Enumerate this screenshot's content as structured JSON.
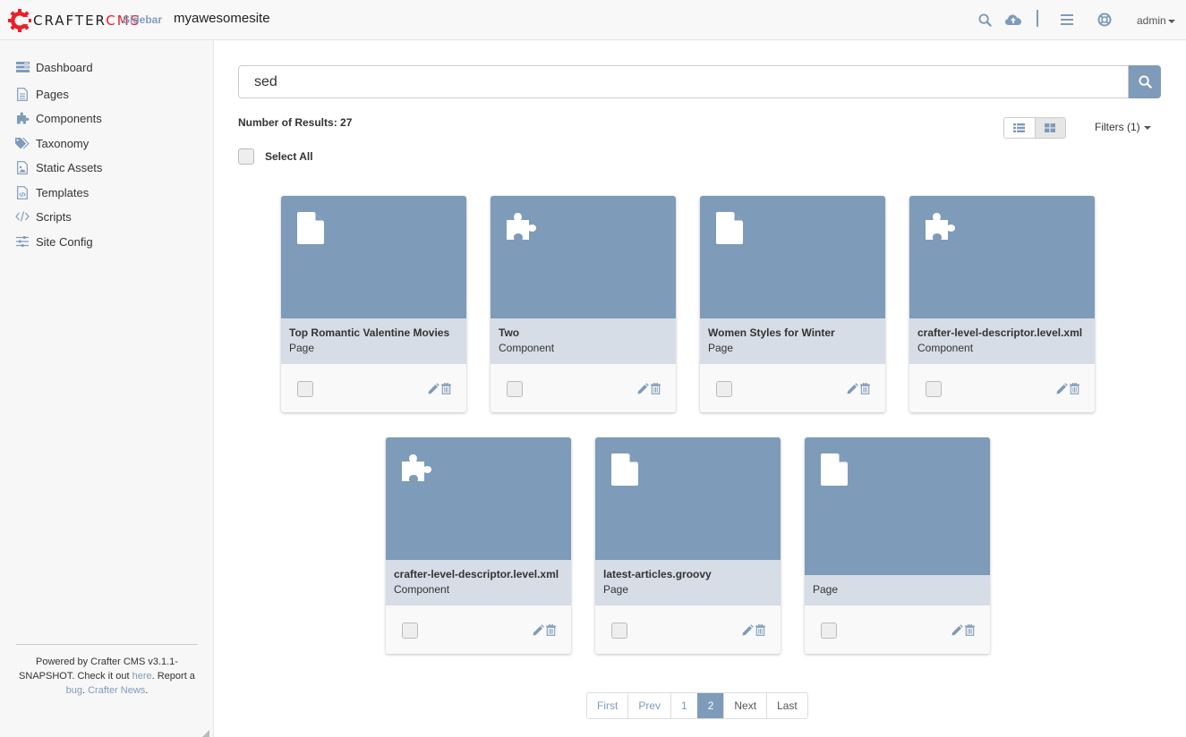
{
  "header": {
    "logo_prefix": "CRAFTER",
    "logo_suffix": "CMS",
    "sidebar_toggle": "Sidebar",
    "site_name": "myawesomesite",
    "icons": [
      "search-icon",
      "cloud-upload-icon",
      "menu-icon",
      "help-lifebuoy-icon"
    ],
    "user": "admin"
  },
  "sidebar": {
    "items": [
      {
        "label": "Dashboard",
        "icon": "dashboard-icon"
      },
      {
        "label": "Pages",
        "icon": "page-icon"
      },
      {
        "label": "Components",
        "icon": "puzzle-icon"
      },
      {
        "label": "Taxonomy",
        "icon": "tags-icon"
      },
      {
        "label": "Static Assets",
        "icon": "image-file-icon"
      },
      {
        "label": "Templates",
        "icon": "code-file-icon"
      },
      {
        "label": "Scripts",
        "icon": "code-icon"
      },
      {
        "label": "Site Config",
        "icon": "sliders-icon"
      }
    ],
    "footer": {
      "text1": "Powered by Crafter CMS v3.1.1-SNAPSHOT. Check it out ",
      "link_here": "here",
      "text2": ". Report a ",
      "link_bug": "bug",
      "text3": ". ",
      "link_news": "Crafter News",
      "text4": "."
    }
  },
  "search": {
    "value": "sed",
    "placeholder": ""
  },
  "results": {
    "label": "Number of Results",
    "count": "27",
    "select_all": "Select All",
    "filters": "Filters (1)",
    "view_modes": [
      "list-view",
      "grid-view"
    ],
    "active_view": "grid-view"
  },
  "cards": [
    {
      "name": "Top Romantic Valentine Movies",
      "type": "Page",
      "icon": "page"
    },
    {
      "name": "Two",
      "type": "Component",
      "icon": "component"
    },
    {
      "name": "Women Styles for Winter",
      "type": "Page",
      "icon": "page"
    },
    {
      "name": "crafter-level-descriptor.level.xml",
      "type": "Component",
      "icon": "component"
    },
    {
      "name": "crafter-level-descriptor.level.xml",
      "type": "Component",
      "icon": "component"
    },
    {
      "name": "latest-articles.groovy",
      "type": "Page",
      "icon": "page"
    },
    {
      "name": "",
      "type": "Page",
      "icon": "page"
    }
  ],
  "pagination": {
    "first": "First",
    "prev": "Prev",
    "pages": [
      "1",
      "2"
    ],
    "current": "2",
    "next": "Next",
    "last": "Last"
  },
  "colors": {
    "accent": "#7e9bb9",
    "card_info_bg": "#d6dde6",
    "brand_red": "#e8202a"
  }
}
